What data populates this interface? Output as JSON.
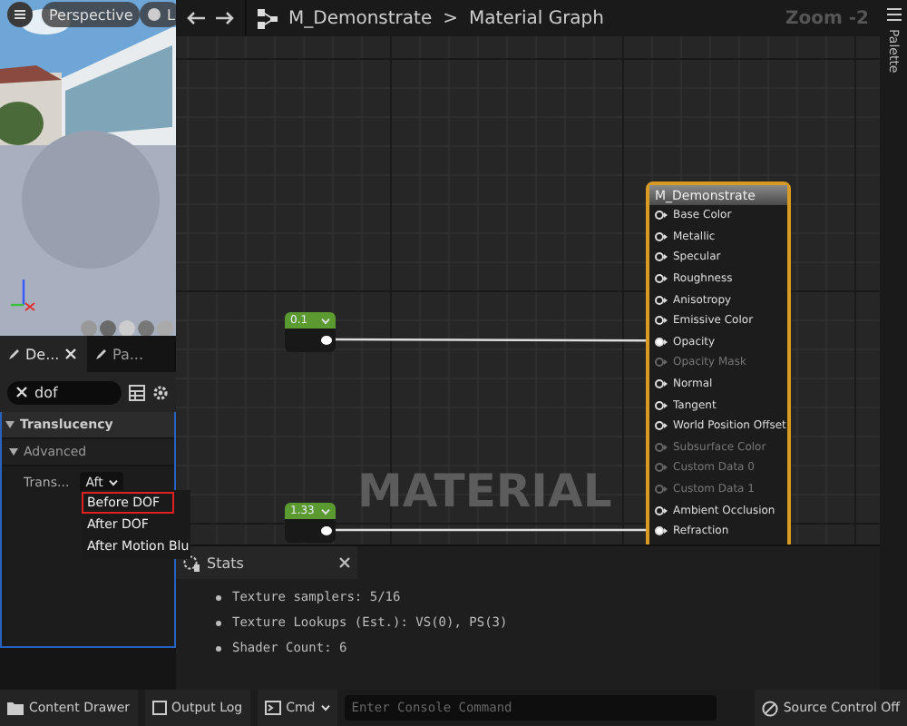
{
  "viewport": {
    "view_mode": "Perspective",
    "lighting": "L"
  },
  "panel_tabs": [
    {
      "label": "De...",
      "selected": true,
      "closable": true
    },
    {
      "label": "Pa...",
      "selected": false,
      "closable": false
    }
  ],
  "search": {
    "value": "dof"
  },
  "details": {
    "category": "Translucency",
    "subcategory": "Advanced",
    "property": {
      "label": "Trans...",
      "value": "Aft"
    }
  },
  "dropdown_menu": [
    {
      "label": "Before DOF",
      "selected": true
    },
    {
      "label": "After DOF",
      "selected": false
    },
    {
      "label": "After Motion Blu",
      "selected": false
    }
  ],
  "toolbar": {
    "asset": "M_Demonstrate",
    "separator": ">",
    "graph": "Material Graph",
    "zoom": "Zoom -2"
  },
  "side_tab": "Palette",
  "graph": {
    "constants": [
      {
        "value": "0.1"
      },
      {
        "value": "1.33"
      }
    ],
    "result_node": {
      "title": "M_Demonstrate",
      "pins": [
        {
          "label": "Base Color",
          "enabled": true,
          "connected": false
        },
        {
          "label": "Metallic",
          "enabled": true,
          "connected": false
        },
        {
          "label": "Specular",
          "enabled": true,
          "connected": false
        },
        {
          "label": "Roughness",
          "enabled": true,
          "connected": false
        },
        {
          "label": "Anisotropy",
          "enabled": true,
          "connected": false
        },
        {
          "label": "Emissive Color",
          "enabled": true,
          "connected": false
        },
        {
          "label": "Opacity",
          "enabled": true,
          "connected": true
        },
        {
          "label": "Opacity Mask",
          "enabled": false,
          "connected": false
        },
        {
          "label": "Normal",
          "enabled": true,
          "connected": false
        },
        {
          "label": "Tangent",
          "enabled": true,
          "connected": false
        },
        {
          "label": "World Position Offset",
          "enabled": true,
          "connected": false
        },
        {
          "label": "Subsurface Color",
          "enabled": false,
          "connected": false
        },
        {
          "label": "Custom Data 0",
          "enabled": false,
          "connected": false
        },
        {
          "label": "Custom Data 1",
          "enabled": false,
          "connected": false
        },
        {
          "label": "Ambient Occlusion",
          "enabled": true,
          "connected": false
        },
        {
          "label": "Refraction",
          "enabled": true,
          "connected": true
        }
      ]
    },
    "graph_label": "MATERIAL"
  },
  "stats": {
    "title": "Stats",
    "lines": [
      "Texture samplers: 5/16",
      "Texture Lookups (Est.): VS(0), PS(3)",
      "Shader Count: 6"
    ]
  },
  "status_bar": {
    "content_drawer": "Content Drawer",
    "output_log": "Output Log",
    "cmd": "Cmd",
    "console_placeholder": "Enter Console Command",
    "source_control": "Source Control Off"
  }
}
